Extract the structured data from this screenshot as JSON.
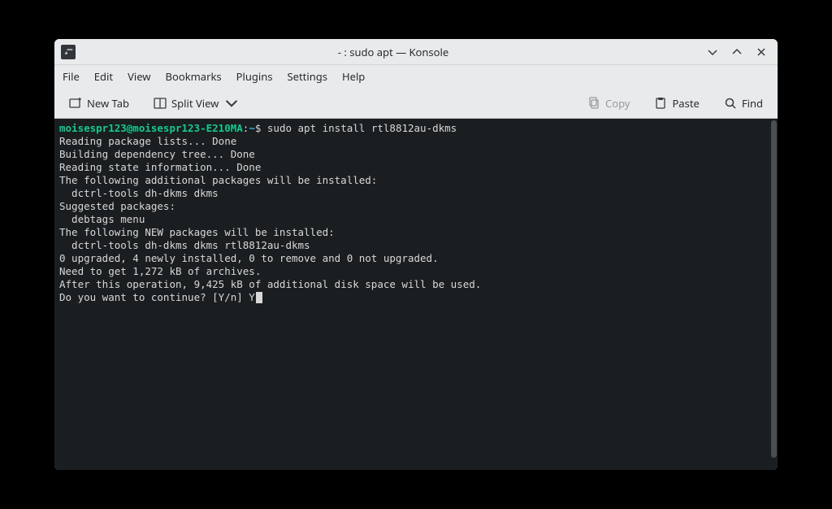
{
  "window": {
    "title": "- : sudo apt — Konsole"
  },
  "menubar": {
    "file": "File",
    "edit": "Edit",
    "view": "View",
    "bookmarks": "Bookmarks",
    "plugins": "Plugins",
    "settings": "Settings",
    "help": "Help"
  },
  "toolbar": {
    "new_tab": "New Tab",
    "split_view": "Split View",
    "copy": "Copy",
    "paste": "Paste",
    "find": "Find"
  },
  "terminal": {
    "prompt_user": "moisespr123@moisespr123-E210MA",
    "prompt_colon": ":",
    "prompt_path": "~",
    "prompt_dollar": "$",
    "command": " sudo apt install rtl8812au-dkms",
    "lines": [
      "Reading package lists... Done",
      "Building dependency tree... Done",
      "Reading state information... Done",
      "The following additional packages will be installed:",
      "  dctrl-tools dh-dkms dkms",
      "Suggested packages:",
      "  debtags menu",
      "The following NEW packages will be installed:",
      "  dctrl-tools dh-dkms dkms rtl8812au-dkms",
      "0 upgraded, 4 newly installed, 0 to remove and 0 not upgraded.",
      "Need to get 1,272 kB of archives.",
      "After this operation, 9,425 kB of additional disk space will be used."
    ],
    "prompt_line": "Do you want to continue? [Y/n] ",
    "input": "Y"
  }
}
